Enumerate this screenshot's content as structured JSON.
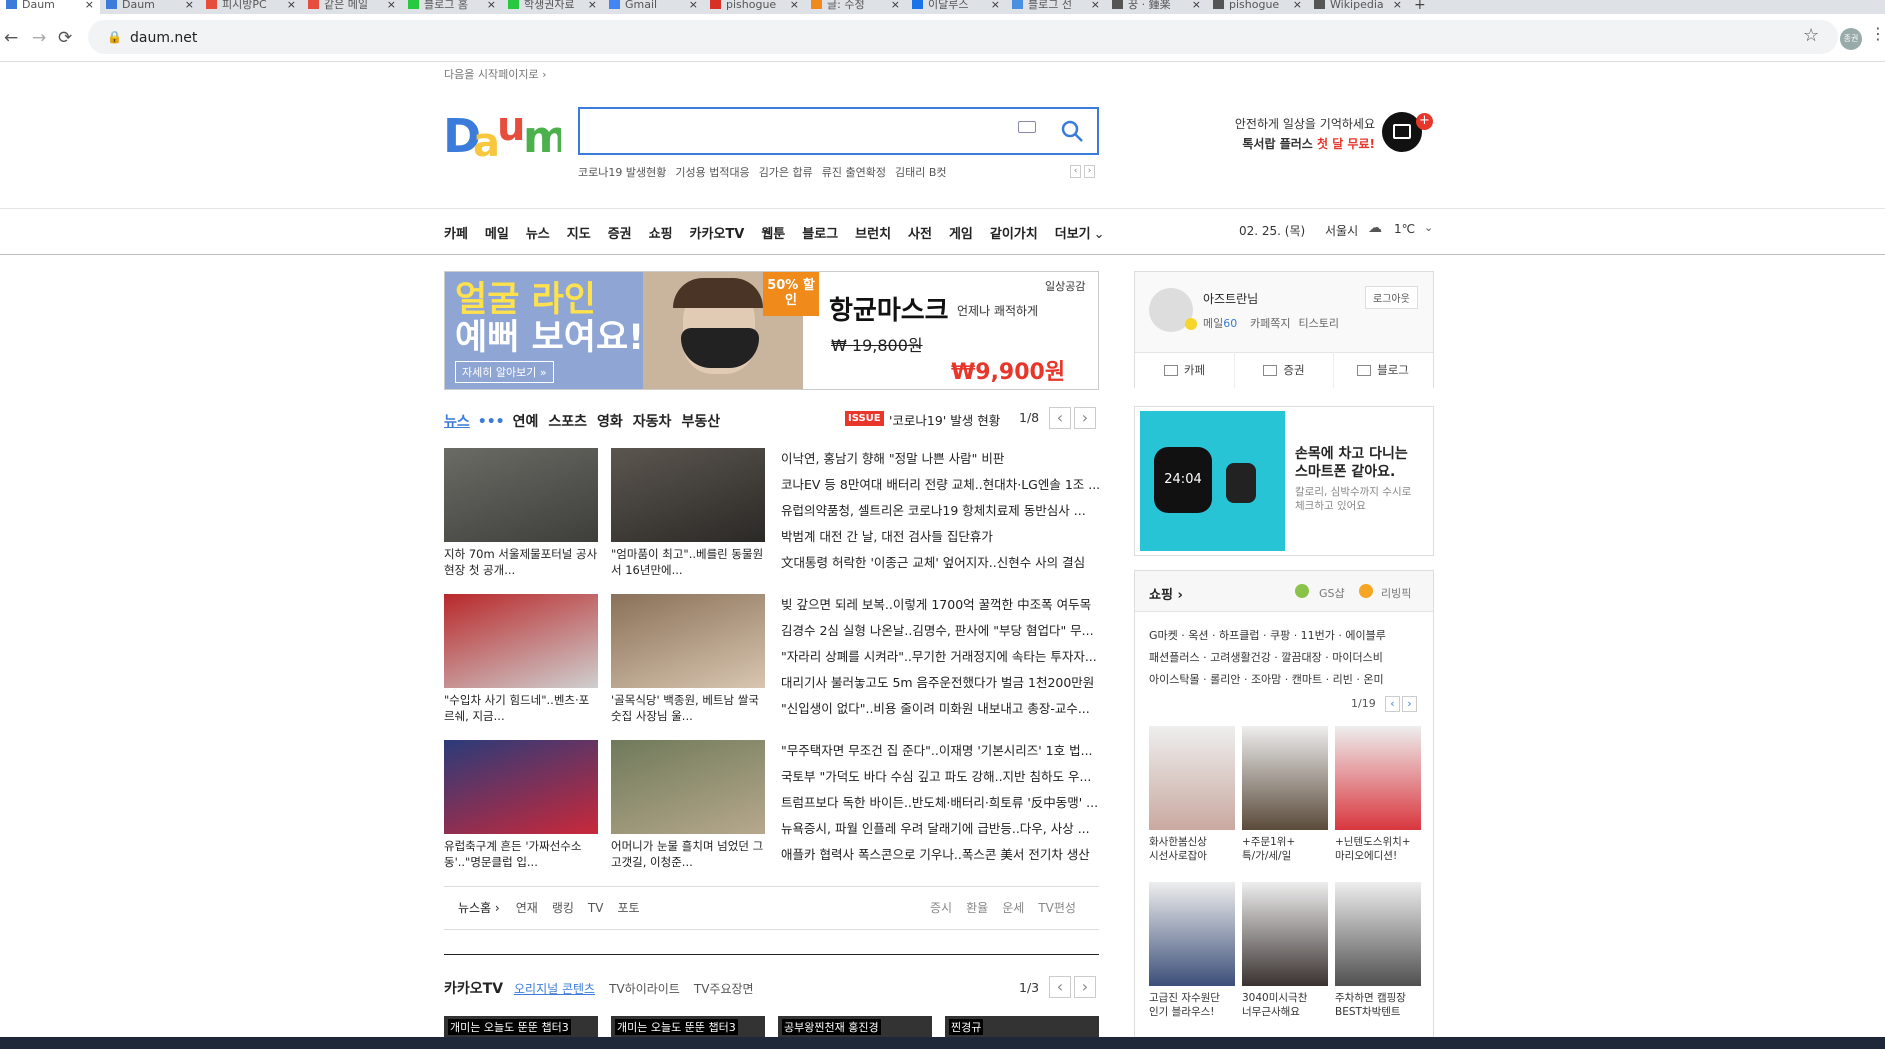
{
  "browser": {
    "tabs": [
      "Daum",
      "Daum",
      "피시방PC",
      "같은 메일",
      "블로그 홈",
      "학생권자료",
      "Gmail",
      "pishogue",
      "글: 수정",
      "이달루스",
      "블로그 선",
      "꿍 · 鍾楽",
      "pishogue",
      "Wikipedia"
    ],
    "url": "daum.net",
    "profile": "종권"
  },
  "top": {
    "startpage": "다음을 시작페이지로 ›",
    "logo": "Daum",
    "search_placeholder": "",
    "hot_keywords": [
      "코로나19 발생현황",
      "기성용 법적대응",
      "김가은 합류",
      "류진 출연확정",
      "김태리 B컷"
    ],
    "promo_line1": "안전하게 일상을 기억하세요",
    "promo_line2": "톡서랍 플러스",
    "promo_highlight": "첫 달 무료!"
  },
  "gnb": {
    "items": [
      "카페",
      "메일",
      "뉴스",
      "지도",
      "증권",
      "쇼핑",
      "카카오TV",
      "웹툰",
      "블로그",
      "브런치",
      "사전",
      "게임",
      "같이가치",
      "더보기"
    ],
    "date": "02. 25. (목)",
    "city": "서울시",
    "temp": "1℃"
  },
  "banner": {
    "left_line1": "얼굴 라인",
    "left_line2": "예뻐 보여요!",
    "left_more": "자세히 알아보기 »",
    "badge": "50% 할인",
    "product": "항균마스크",
    "product_sub": "언제나 쾌적하게",
    "brand": "일상공감",
    "old_price": "₩ 19,800원",
    "new_price": "₩9,900원"
  },
  "news": {
    "tabs": [
      "뉴스",
      "연예",
      "스포츠",
      "영화",
      "자동차",
      "부동산"
    ],
    "issue_badge": "ISSUE",
    "issue_text": "'코로나19' 발생 현황",
    "page": "1/8",
    "thumb_captions": [
      "지하 70m 서울제물포터널 공사현장 첫 공개...",
      "\"엄마품이 최고\"..베를린 동물원서 16년만에...",
      "\"수입차 사기 힘드네\"..벤츠·포르쉐, 지금...",
      "'골목식당' 백종원, 베트남 쌀국숫집 사장님 울...",
      "유럽축구계 흔든 '가짜선수소동'..\"명문클럽 입...",
      "어머니가 눈물 흘치며 넘었던 그 고갯길, 이청준..."
    ],
    "headlines": [
      "이낙연, 홍남기 향해 \"정말 나쁜 사람\" 비판",
      "코나EV 등 8만여대 배터리 전량 교체..현대차·LG엔솔 1조 ...",
      "유럽의약품청, 셀트리온 코로나19 항체치료제 동반심사 ...",
      "박범계 대전 간 날, 대전 검사들 집단휴가",
      "文대통령 허락한 '이종근 교체' 엎어지자..신현수 사의 결심",
      "빚 갚으면 되레 보복..이렇게 1700억 꿀꺽한 中조폭 여두목",
      "김경수 2심 실형 나온날..김명수, 판사에 \"부당 혐업다\" 무...",
      "\"자라리 상폐를 시켜라\"..무기한 거래정지에 속타는 투자자...",
      "대리기사 불러놓고도 5m 음주운전했다가 벌금 1천200만원",
      "\"신입생이 없다\"..비용 줄이려 미화원 내보내고 총장-교수...",
      "\"무주택자면 무조건 집 준다\"..이재명 '기본시리즈' 1호 법...",
      "국토부 \"가덕도 바다 수심 깊고 파도 강해..지반 침하도 우...",
      "트럼프보다 독한 바이든..반도체·배터리·희토류 '反中동맹' ...",
      "뉴욕증시, 파월 인플레 우려 달래기에 급반등..다우, 사상 ...",
      "애플카 협력사 폭스콘으로 기우나..폭스콘 美서 전기차 생산"
    ],
    "footer_left": [
      "뉴스홈 ›",
      "연재",
      "랭킹",
      "TV",
      "포토"
    ],
    "footer_right": [
      "증시",
      "환율",
      "운세",
      "TV편성"
    ]
  },
  "kakaotv": {
    "title": "카카오TV",
    "tabs": [
      "오리지널 콘텐츠",
      "TV하이라이트",
      "TV주요장면"
    ],
    "page": "1/3",
    "thumbs": [
      "개미는 오늘도 뚠뚠 챕터3",
      "개미는 오늘도 뚠뚠 챕터3",
      "공부왕찐천재 홍진경",
      "찐경규"
    ]
  },
  "login": {
    "name": "아즈트란님",
    "logout": "로그아웃",
    "mail_label": "메일",
    "mail_count": "60",
    "links": [
      "카페쪽지",
      "티스토리"
    ],
    "quick": [
      "카페",
      "증권",
      "블로그"
    ]
  },
  "ad": {
    "watch_time": "24:04",
    "title1": "손목에 차고 다니는",
    "title2": "스마트폰 같아요.",
    "desc1": "칼로리, 심박수까지 수시로",
    "desc2": "체크하고 있어요"
  },
  "shopping": {
    "title": "쇼핑 ›",
    "partners": [
      "GS샵",
      "리빙픽"
    ],
    "malls": [
      "G마켓 · 옥션 · 하프클럽 · 쿠팡 · 11번가 · 에이블루",
      "패션플러스 · 고려생활건강 · 깔끔대장 · 마이더스비",
      "아이스탁몰 · 롤리안 · 조아맘 · 캔마트 · 리빈 · 온미"
    ],
    "page": "1/19",
    "products": [
      {
        "l1": "화사한봄신상",
        "l2": "시선사로잡아"
      },
      {
        "l1": "+주문1위+",
        "l2": "특/가/세/일"
      },
      {
        "l1": "+닌텐도스위치+",
        "l2": "마리오에디션!"
      },
      {
        "l1": "고급진 자수원단",
        "l2": "인기 블라우스!"
      },
      {
        "l1": "3040미시극찬",
        "l2": "너무근사해요"
      },
      {
        "l1": "주차하면 캠핑장",
        "l2": "BEST차박텐트"
      }
    ]
  },
  "colors": {
    "daum_blue": "#3b7bd9",
    "daum_red": "#e64d3d",
    "daum_yellow": "#f7c73d",
    "daum_green": "#4cb04c",
    "issue_red": "#e8362b"
  }
}
